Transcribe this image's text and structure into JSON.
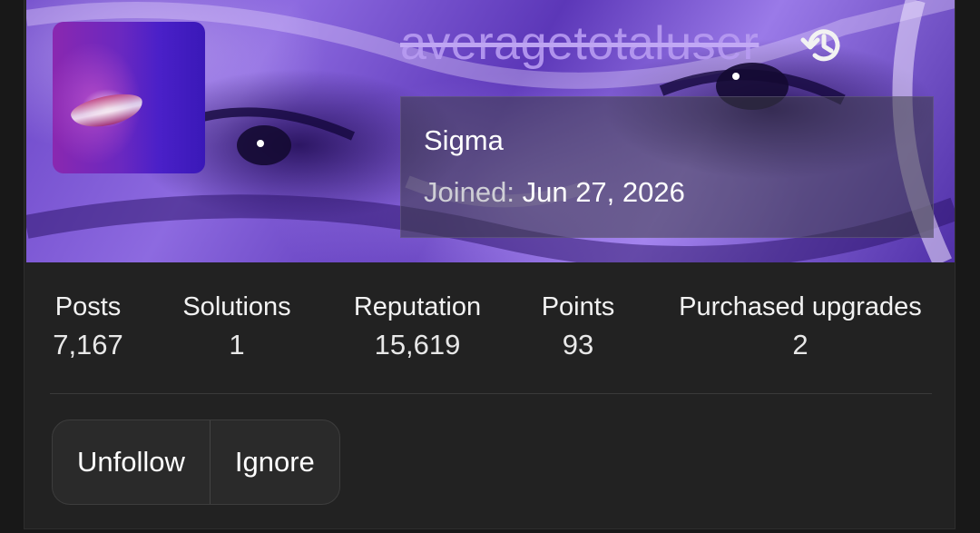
{
  "profile": {
    "username": "averagetotaluser",
    "user_title": "Sigma",
    "joined_label": "Joined:",
    "joined_date": "Jun 27, 2026",
    "history_icon": "history-icon"
  },
  "stats": [
    {
      "label": "Posts",
      "value": "7,167"
    },
    {
      "label": "Solutions",
      "value": "1"
    },
    {
      "label": "Reputation",
      "value": "15,619"
    },
    {
      "label": "Points",
      "value": "93"
    },
    {
      "label": "Purchased upgrades",
      "value": "2"
    }
  ],
  "actions": {
    "unfollow_label": "Unfollow",
    "ignore_label": "Ignore"
  },
  "colors": {
    "background": "#181818",
    "card": "#222222",
    "username": "#b89cf2",
    "banner_accent": "#6c46c8"
  }
}
